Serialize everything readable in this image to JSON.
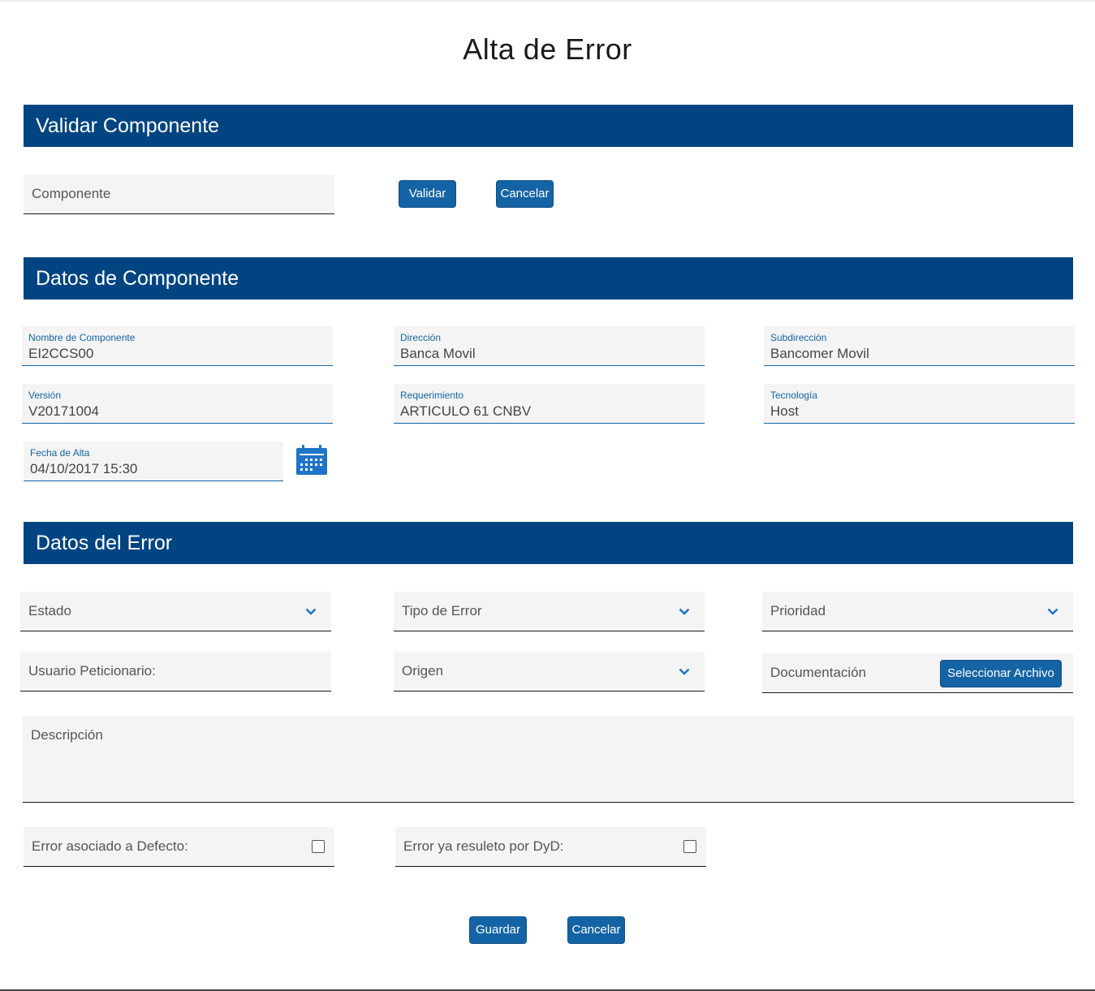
{
  "page_title": "Alta de Error",
  "sections": {
    "validar": "Validar Componente",
    "datos_componente": "Datos de Componente",
    "datos_error": "Datos del Error"
  },
  "validar": {
    "componente_placeholder": "Componente",
    "validar_button": "Validar",
    "cancelar_button": "Cancelar"
  },
  "componente": {
    "nombre": {
      "label": "Nombre de Componente",
      "value": "EI2CCS00"
    },
    "direccion": {
      "label": "Dirección",
      "value": "Banca Movil"
    },
    "subdireccion": {
      "label": "Subdirección",
      "value": "Bancomer Movil"
    },
    "version": {
      "label": "Versión",
      "value": "V20171004"
    },
    "requerimiento": {
      "label": "Requerimiento",
      "value": "ARTICULO 61 CNBV"
    },
    "tecnologia": {
      "label": "Tecnología",
      "value": "Host"
    },
    "fecha_alta": {
      "label": "Fecha de Alta",
      "value": "04/10/2017 15:30"
    },
    "calendar_icon": "calendar-icon"
  },
  "error": {
    "estado": "Estado",
    "tipo_error": "Tipo de Error",
    "prioridad": "Prioridad",
    "usuario_peticionario": "Usuario Peticionario:",
    "origen": "Origen",
    "documentacion": "Documentación",
    "seleccionar_archivo": "Seleccionar Archivo",
    "descripcion": "Descripción",
    "error_asociado": "Error asociado a Defecto:",
    "error_resuelto": "Error ya resuleto por DyD:"
  },
  "actions": {
    "guardar": "Guardar",
    "cancelar": "Cancelar"
  },
  "colors": {
    "primary": "#004481",
    "button": "#1464a5",
    "field_bg": "#f4f4f4"
  }
}
